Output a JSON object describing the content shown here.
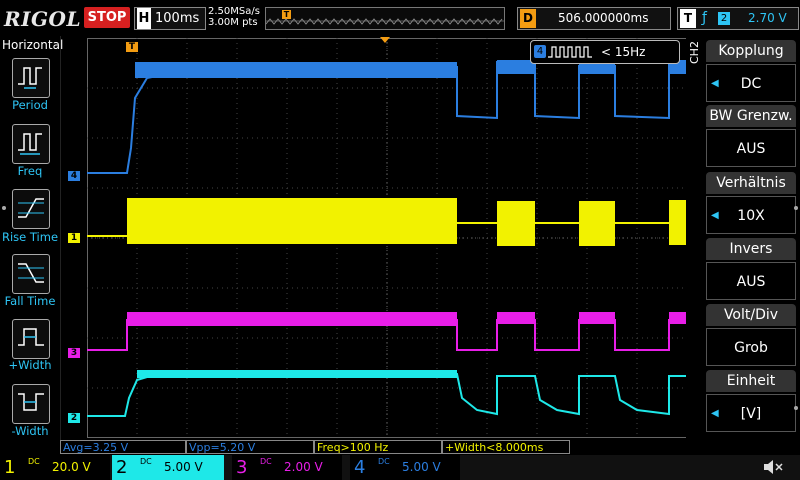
{
  "header": {
    "logo": "RIGOL",
    "run_state": "STOP",
    "timebase_key": "H",
    "timebase": "100ms",
    "sample_rate": "2.50MSa/s",
    "memory_depth": "3.00M pts",
    "trigger_marker": "T",
    "delay_key": "D",
    "delay": "506.000000ms",
    "trigger_key": "T",
    "trigger_edge": "rising-edge-icon",
    "trigger_source": "2",
    "trigger_level": "2.70 V"
  },
  "left_menu": {
    "title": "Horizontal",
    "items": [
      {
        "label": "Period",
        "icon": "period-icon"
      },
      {
        "label": "Freq",
        "icon": "frequency-icon"
      },
      {
        "label": "Rise Time",
        "icon": "rise-time-icon"
      },
      {
        "label": "Fall Time",
        "icon": "fall-time-icon"
      },
      {
        "label": "+Width",
        "icon": "positive-width-icon"
      },
      {
        "label": "-Width",
        "icon": "negative-width-icon"
      }
    ]
  },
  "right_menu": {
    "channel_label": "CH2",
    "items": [
      {
        "header": "Kopplung",
        "value": "DC"
      },
      {
        "header": "BW Grenzw.",
        "value": "AUS"
      },
      {
        "header": "Verhältnis",
        "value": "10X"
      },
      {
        "header": "Invers",
        "value": "AUS"
      },
      {
        "header": "Volt/Div",
        "value": "Grob"
      },
      {
        "header": "Einheit",
        "value": "[V]"
      }
    ]
  },
  "freq_counter": {
    "channel": "4",
    "value": "< 15Hz"
  },
  "measurements": [
    {
      "label": "Avg=3.25 V",
      "color": "#2b7ee0"
    },
    {
      "label": "Vpp=5.20 V",
      "color": "#2b7ee0"
    },
    {
      "label": "Freq>100 Hz",
      "color": "#f2f200"
    },
    {
      "label": "+Width<8.000ms",
      "color": "#f2f200"
    }
  ],
  "channels": [
    {
      "num": "1",
      "coupling": "DC",
      "scale": "20.0 V",
      "color": "#f2f200"
    },
    {
      "num": "2",
      "coupling": "DC",
      "scale": "5.00 V",
      "color": "#1ee8e8"
    },
    {
      "num": "3",
      "coupling": "DC",
      "scale": "2.00 V",
      "color": "#e81ee8"
    },
    {
      "num": "4",
      "coupling": "DC",
      "scale": "5.00 V",
      "color": "#2b7ee0"
    }
  ],
  "trace_markers": [
    {
      "label": "4",
      "color": "#2b7ee0"
    },
    {
      "label": "1",
      "color": "#f2f200"
    },
    {
      "label": "3",
      "color": "#e81ee8"
    },
    {
      "label": "2",
      "color": "#1ee8e8"
    }
  ],
  "trigger_level_marker": "T",
  "speaker_icon": "speaker-muted-icon"
}
